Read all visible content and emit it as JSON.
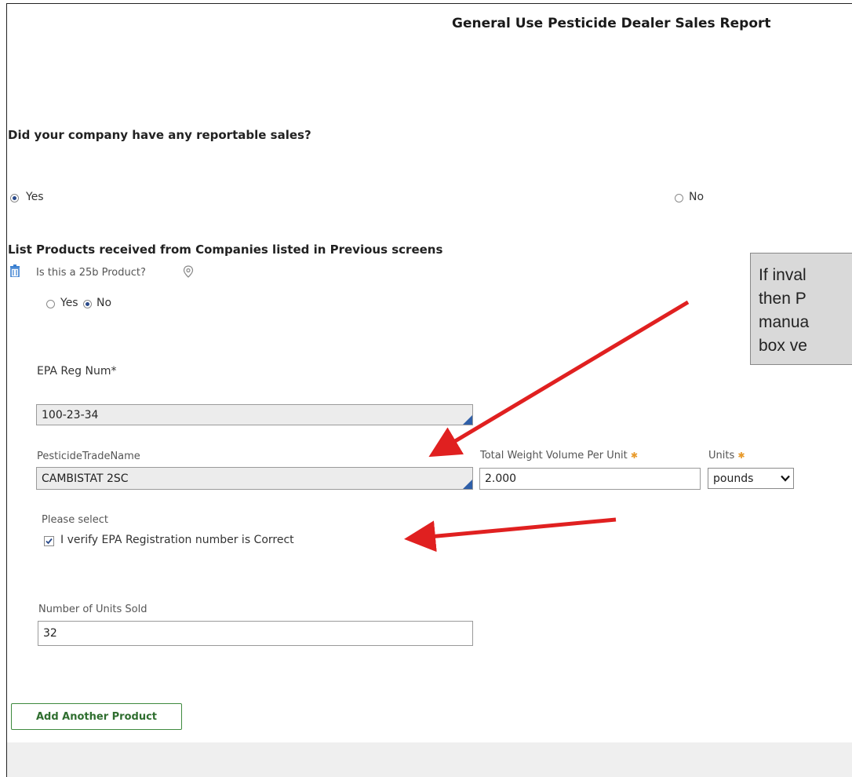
{
  "report": {
    "title": "General Use Pesticide Dealer Sales Report",
    "question": "Did your company have any reportable sales?",
    "yes_label": "Yes",
    "no_label": "No",
    "selected": "Yes"
  },
  "products": {
    "section_title": "List Products received from Companies listed in Previous screens",
    "is_25b_label": "Is this a 25b Product?",
    "yes_label": "Yes",
    "no_label": "No",
    "selected": "No",
    "epa_reg_label": "EPA Reg Num*",
    "epa_reg_value": "100-23-34",
    "trade_name_label": "PesticideTradeName",
    "trade_name_value": "CAMBISTAT 2SC",
    "weight_label": "Total Weight Volume Per Unit",
    "weight_value": "2.000",
    "units_label": "Units",
    "units_value": "pounds",
    "please_select_label": "Please select",
    "verify_label": "I verify EPA Registration number is Correct",
    "verify_checked": true,
    "units_sold_label": "Number of Units Sold",
    "units_sold_value": "32",
    "add_button": "Add Another Product"
  },
  "callout": {
    "lines": [
      "If inval",
      "then P",
      "manua",
      "box ve"
    ]
  },
  "colors": {
    "arrow": "#e02020",
    "button_border": "#3e8a3e",
    "required_star": "#e89a2c",
    "field_corner": "#2f5fa8"
  }
}
